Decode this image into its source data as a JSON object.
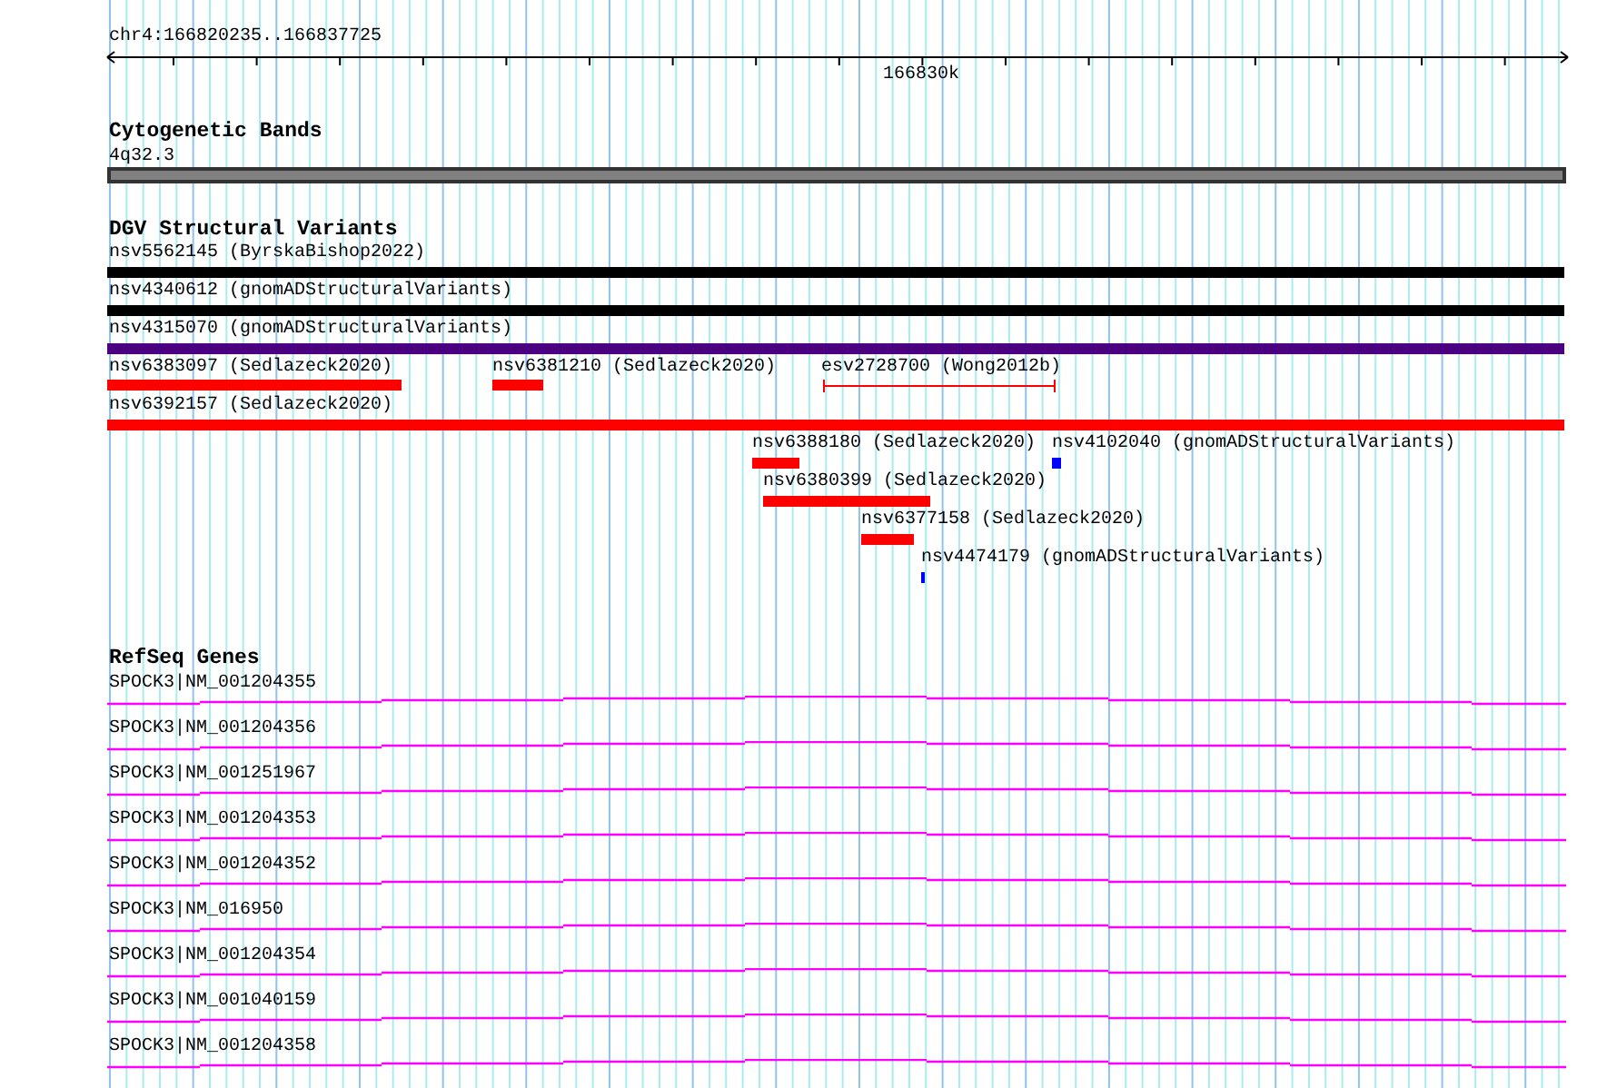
{
  "ruler": {
    "range": "chr4:166820235..166837725",
    "tick_label": "166830k"
  },
  "tracks": [
    {
      "kind": "cytoband",
      "title": "Cytogenetic Bands",
      "features": [
        {
          "label": "4q32.3",
          "color": "#808080"
        }
      ]
    },
    {
      "kind": "variants",
      "title": "DGV Structural Variants",
      "features": [
        {
          "label": "nsv5562145 (ByrskaBishop2022)",
          "kind": "bar",
          "color": "#000000"
        },
        {
          "label": "nsv4340612 (gnomADStructuralVariants)",
          "kind": "bar",
          "color": "#000000"
        },
        {
          "label": "nsv4315070 (gnomADStructuralVariants)",
          "kind": "bar",
          "color": "#4b0082"
        },
        {
          "label": "nsv6383097 (Sedlazeck2020)",
          "kind": "bar",
          "color": "#ff0000"
        },
        {
          "label": "nsv6381210 (Sedlazeck2020)",
          "kind": "bar",
          "color": "#ff0000"
        },
        {
          "label": "esv2728700 (Wong2012b)",
          "kind": "span",
          "color": "#ff0000"
        },
        {
          "label": "nsv6392157 (Sedlazeck2020)",
          "kind": "bar",
          "color": "#ff0000"
        },
        {
          "label": "nsv6388180 (Sedlazeck2020)",
          "kind": "bar",
          "color": "#ff0000"
        },
        {
          "label": "nsv4102040 (gnomADStructuralVariants)",
          "kind": "bar",
          "color": "#0000ff"
        },
        {
          "label": "nsv6380399 (Sedlazeck2020)",
          "kind": "bar",
          "color": "#ff0000"
        },
        {
          "label": "nsv6377158 (Sedlazeck2020)",
          "kind": "bar",
          "color": "#ff0000"
        },
        {
          "label": "nsv4474179 (gnomADStructuralVariants)",
          "kind": "bar",
          "color": "#0000ff"
        }
      ]
    },
    {
      "kind": "genes",
      "title": "RefSeq Genes",
      "features": [
        {
          "label": "SPOCK3|NM_001204355",
          "color": "#ff00ff"
        },
        {
          "label": "SPOCK3|NM_001204356",
          "color": "#ff00ff"
        },
        {
          "label": "SPOCK3|NM_001251967",
          "color": "#ff00ff"
        },
        {
          "label": "SPOCK3|NM_001204353",
          "color": "#ff00ff"
        },
        {
          "label": "SPOCK3|NM_001204352",
          "color": "#ff00ff"
        },
        {
          "label": "SPOCK3|NM_016950",
          "color": "#ff00ff"
        },
        {
          "label": "SPOCK3|NM_001204354",
          "color": "#ff00ff"
        },
        {
          "label": "SPOCK3|NM_001040159",
          "color": "#ff00ff"
        },
        {
          "label": "SPOCK3|NM_001204358",
          "color": "#ff00ff"
        }
      ]
    }
  ]
}
